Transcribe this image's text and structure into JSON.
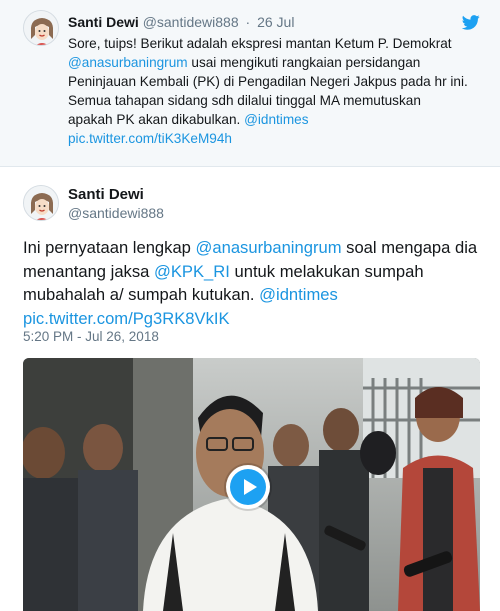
{
  "colors": {
    "link": "#1b95e0",
    "twitter_blue": "#1da1f2",
    "muted": "#657786",
    "text": "#14171a",
    "quoted_bg": "#f5f8fa"
  },
  "quoted_tweet": {
    "avatar_icon": "avatar-cartoon-icon",
    "name": "Santi Dewi",
    "handle": "@santidewi888",
    "separator": "·",
    "date": "26 Jul",
    "brand_icon": "twitter-bird-icon",
    "text": {
      "l1": "Sore, tuips! Berikut adalah ekspresi mantan Ketum P. Demokrat",
      "l2_mention": "@anasurbaningrum",
      "l2_rest": " usai mengikuti rangkaian persidangan",
      "l3": "Peninjauan Kembali (PK) di Pengadilan Negeri Jakpus pada hr ini.",
      "l4": "Semua tahapan sidang sdh dilalui tinggal MA memutuskan",
      "l5_text": "apakah PK akan dikabulkan. ",
      "l5_mention": "@idntimes",
      "l6_link": "pic.twitter.com/tiK3KeM94h"
    }
  },
  "main_tweet": {
    "avatar_icon": "avatar-cartoon-icon",
    "name": "Santi Dewi",
    "handle": "@santidewi888",
    "text": {
      "l1_text": "Ini pernyataan lengkap ",
      "l1_mention": "@anasurbaningrum",
      "l1_rest": " soal mengapa dia",
      "l2_text": "menantang jaksa ",
      "l2_mention": "@KPK_RI",
      "l2_rest": " untuk melakukan sumpah",
      "l3_text": "mubahalah a/ sumpah kutukan. ",
      "l3_mention": "@idntimes",
      "l4_link": "pic.twitter.com/Pg3RK8VkIK"
    },
    "timestamp": "5:20 PM - Jul 26, 2018",
    "media": {
      "type": "video",
      "play_icon": "play-icon"
    }
  }
}
